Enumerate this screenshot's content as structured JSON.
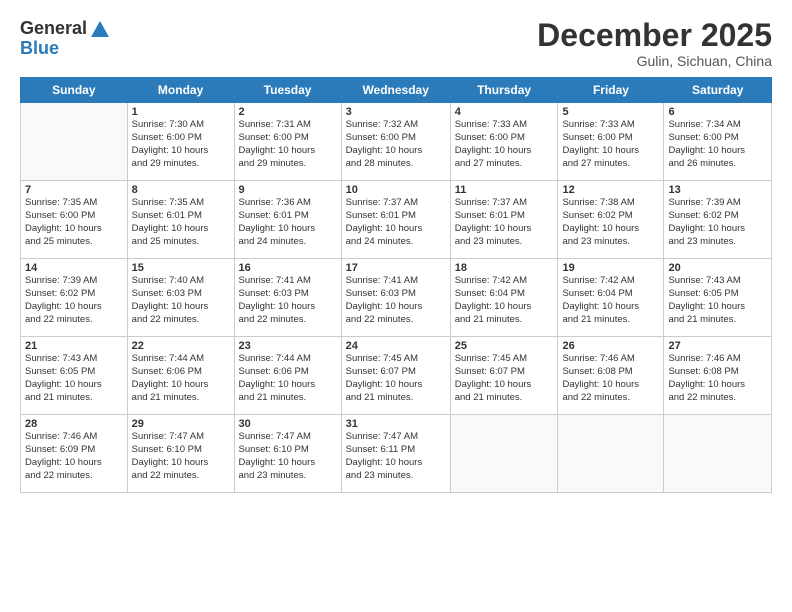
{
  "header": {
    "logo_general": "General",
    "logo_blue": "Blue",
    "month_year": "December 2025",
    "location": "Gulin, Sichuan, China"
  },
  "weekdays": [
    "Sunday",
    "Monday",
    "Tuesday",
    "Wednesday",
    "Thursday",
    "Friday",
    "Saturday"
  ],
  "weeks": [
    [
      {
        "num": "",
        "sunrise": "",
        "sunset": "",
        "daylight": ""
      },
      {
        "num": "1",
        "sunrise": "Sunrise: 7:30 AM",
        "sunset": "Sunset: 6:00 PM",
        "daylight": "Daylight: 10 hours and 29 minutes."
      },
      {
        "num": "2",
        "sunrise": "Sunrise: 7:31 AM",
        "sunset": "Sunset: 6:00 PM",
        "daylight": "Daylight: 10 hours and 29 minutes."
      },
      {
        "num": "3",
        "sunrise": "Sunrise: 7:32 AM",
        "sunset": "Sunset: 6:00 PM",
        "daylight": "Daylight: 10 hours and 28 minutes."
      },
      {
        "num": "4",
        "sunrise": "Sunrise: 7:33 AM",
        "sunset": "Sunset: 6:00 PM",
        "daylight": "Daylight: 10 hours and 27 minutes."
      },
      {
        "num": "5",
        "sunrise": "Sunrise: 7:33 AM",
        "sunset": "Sunset: 6:00 PM",
        "daylight": "Daylight: 10 hours and 27 minutes."
      },
      {
        "num": "6",
        "sunrise": "Sunrise: 7:34 AM",
        "sunset": "Sunset: 6:00 PM",
        "daylight": "Daylight: 10 hours and 26 minutes."
      }
    ],
    [
      {
        "num": "7",
        "sunrise": "Sunrise: 7:35 AM",
        "sunset": "Sunset: 6:00 PM",
        "daylight": "Daylight: 10 hours and 25 minutes."
      },
      {
        "num": "8",
        "sunrise": "Sunrise: 7:35 AM",
        "sunset": "Sunset: 6:01 PM",
        "daylight": "Daylight: 10 hours and 25 minutes."
      },
      {
        "num": "9",
        "sunrise": "Sunrise: 7:36 AM",
        "sunset": "Sunset: 6:01 PM",
        "daylight": "Daylight: 10 hours and 24 minutes."
      },
      {
        "num": "10",
        "sunrise": "Sunrise: 7:37 AM",
        "sunset": "Sunset: 6:01 PM",
        "daylight": "Daylight: 10 hours and 24 minutes."
      },
      {
        "num": "11",
        "sunrise": "Sunrise: 7:37 AM",
        "sunset": "Sunset: 6:01 PM",
        "daylight": "Daylight: 10 hours and 23 minutes."
      },
      {
        "num": "12",
        "sunrise": "Sunrise: 7:38 AM",
        "sunset": "Sunset: 6:02 PM",
        "daylight": "Daylight: 10 hours and 23 minutes."
      },
      {
        "num": "13",
        "sunrise": "Sunrise: 7:39 AM",
        "sunset": "Sunset: 6:02 PM",
        "daylight": "Daylight: 10 hours and 23 minutes."
      }
    ],
    [
      {
        "num": "14",
        "sunrise": "Sunrise: 7:39 AM",
        "sunset": "Sunset: 6:02 PM",
        "daylight": "Daylight: 10 hours and 22 minutes."
      },
      {
        "num": "15",
        "sunrise": "Sunrise: 7:40 AM",
        "sunset": "Sunset: 6:03 PM",
        "daylight": "Daylight: 10 hours and 22 minutes."
      },
      {
        "num": "16",
        "sunrise": "Sunrise: 7:41 AM",
        "sunset": "Sunset: 6:03 PM",
        "daylight": "Daylight: 10 hours and 22 minutes."
      },
      {
        "num": "17",
        "sunrise": "Sunrise: 7:41 AM",
        "sunset": "Sunset: 6:03 PM",
        "daylight": "Daylight: 10 hours and 22 minutes."
      },
      {
        "num": "18",
        "sunrise": "Sunrise: 7:42 AM",
        "sunset": "Sunset: 6:04 PM",
        "daylight": "Daylight: 10 hours and 21 minutes."
      },
      {
        "num": "19",
        "sunrise": "Sunrise: 7:42 AM",
        "sunset": "Sunset: 6:04 PM",
        "daylight": "Daylight: 10 hours and 21 minutes."
      },
      {
        "num": "20",
        "sunrise": "Sunrise: 7:43 AM",
        "sunset": "Sunset: 6:05 PM",
        "daylight": "Daylight: 10 hours and 21 minutes."
      }
    ],
    [
      {
        "num": "21",
        "sunrise": "Sunrise: 7:43 AM",
        "sunset": "Sunset: 6:05 PM",
        "daylight": "Daylight: 10 hours and 21 minutes."
      },
      {
        "num": "22",
        "sunrise": "Sunrise: 7:44 AM",
        "sunset": "Sunset: 6:06 PM",
        "daylight": "Daylight: 10 hours and 21 minutes."
      },
      {
        "num": "23",
        "sunrise": "Sunrise: 7:44 AM",
        "sunset": "Sunset: 6:06 PM",
        "daylight": "Daylight: 10 hours and 21 minutes."
      },
      {
        "num": "24",
        "sunrise": "Sunrise: 7:45 AM",
        "sunset": "Sunset: 6:07 PM",
        "daylight": "Daylight: 10 hours and 21 minutes."
      },
      {
        "num": "25",
        "sunrise": "Sunrise: 7:45 AM",
        "sunset": "Sunset: 6:07 PM",
        "daylight": "Daylight: 10 hours and 21 minutes."
      },
      {
        "num": "26",
        "sunrise": "Sunrise: 7:46 AM",
        "sunset": "Sunset: 6:08 PM",
        "daylight": "Daylight: 10 hours and 22 minutes."
      },
      {
        "num": "27",
        "sunrise": "Sunrise: 7:46 AM",
        "sunset": "Sunset: 6:08 PM",
        "daylight": "Daylight: 10 hours and 22 minutes."
      }
    ],
    [
      {
        "num": "28",
        "sunrise": "Sunrise: 7:46 AM",
        "sunset": "Sunset: 6:09 PM",
        "daylight": "Daylight: 10 hours and 22 minutes."
      },
      {
        "num": "29",
        "sunrise": "Sunrise: 7:47 AM",
        "sunset": "Sunset: 6:10 PM",
        "daylight": "Daylight: 10 hours and 22 minutes."
      },
      {
        "num": "30",
        "sunrise": "Sunrise: 7:47 AM",
        "sunset": "Sunset: 6:10 PM",
        "daylight": "Daylight: 10 hours and 23 minutes."
      },
      {
        "num": "31",
        "sunrise": "Sunrise: 7:47 AM",
        "sunset": "Sunset: 6:11 PM",
        "daylight": "Daylight: 10 hours and 23 minutes."
      },
      {
        "num": "",
        "sunrise": "",
        "sunset": "",
        "daylight": ""
      },
      {
        "num": "",
        "sunrise": "",
        "sunset": "",
        "daylight": ""
      },
      {
        "num": "",
        "sunrise": "",
        "sunset": "",
        "daylight": ""
      }
    ]
  ]
}
